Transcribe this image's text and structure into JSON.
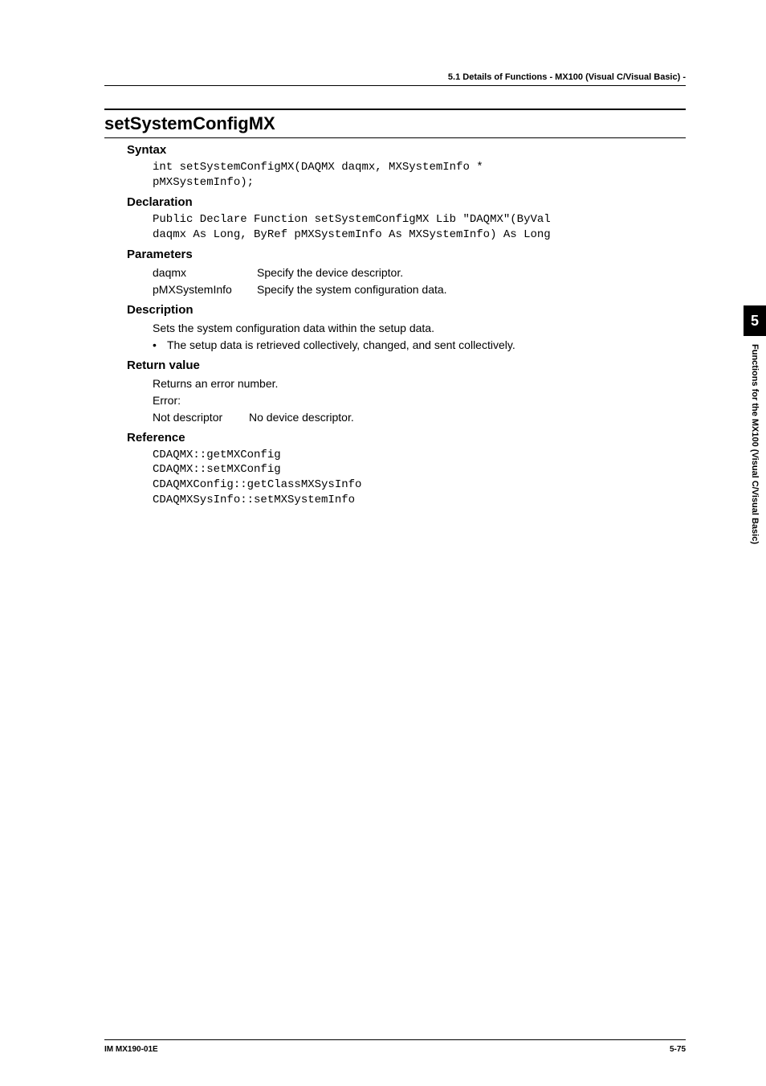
{
  "header": "5.1  Details of Functions - MX100 (Visual C/Visual  Basic) -",
  "functionTitle": "setSystemConfigMX",
  "sections": {
    "syntax": {
      "heading": "Syntax",
      "code": "int setSystemConfigMX(DAQMX daqmx, MXSystemInfo *\npMXSystemInfo);"
    },
    "declaration": {
      "heading": "Declaration",
      "code": "Public Declare Function setSystemConfigMX Lib \"DAQMX\"(ByVal\ndaqmx As Long, ByRef pMXSystemInfo As MXSystemInfo) As Long"
    },
    "parameters": {
      "heading": "Parameters",
      "items": [
        {
          "name": "daqmx",
          "desc": "Specify the device descriptor."
        },
        {
          "name": "pMXSystemInfo",
          "desc": "Specify the system configuration data."
        }
      ]
    },
    "description": {
      "heading": "Description",
      "line": "Sets the system configuration data within the setup data.",
      "bullet": "The setup data is retrieved collectively, changed, and sent collectively."
    },
    "returnValue": {
      "heading": "Return value",
      "line1": "Returns an error number.",
      "line2": "Error:",
      "error": {
        "name": "Not descriptor",
        "desc": "No device descriptor."
      }
    },
    "reference": {
      "heading": "Reference",
      "code": "CDAQMX::getMXConfig\nCDAQMX::setMXConfig\nCDAQMXConfig::getClassMXSysInfo\nCDAQMXSysInfo::setMXSystemInfo"
    }
  },
  "sideTab": {
    "number": "5",
    "text": "Functions for the MX100 (Visual C/Visual Basic)"
  },
  "footer": {
    "left": "IM MX190-01E",
    "right": "5-75"
  }
}
